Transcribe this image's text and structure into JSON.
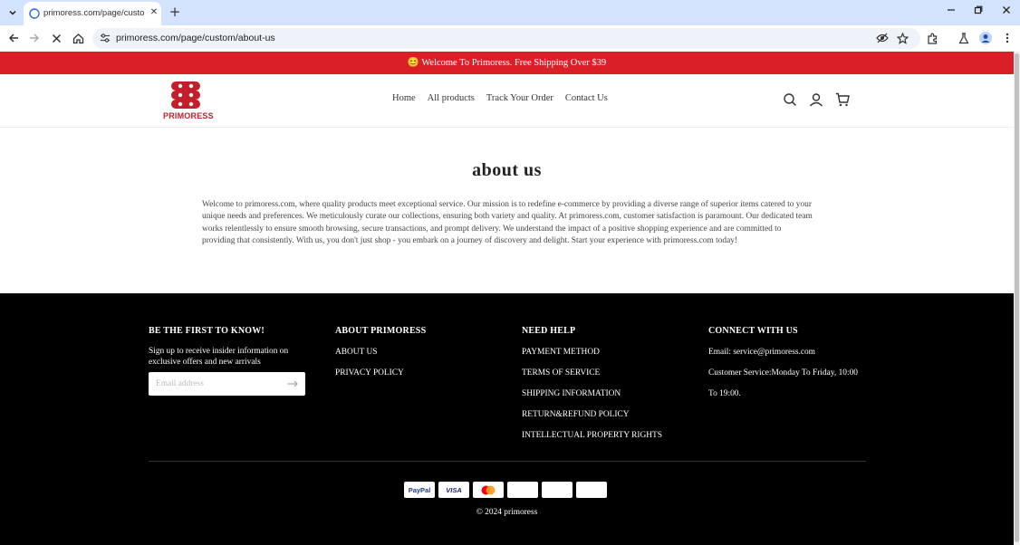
{
  "browser": {
    "tab_title": "primoress.com/page/custom/a",
    "url": "primoress.com/page/custom/about-us",
    "icons": {
      "tab_list": "chevron-down-icon",
      "close_tab": "close-icon",
      "new_tab": "plus-icon",
      "minimize": "minimize-icon",
      "restore": "restore-icon",
      "close_window": "close-icon",
      "back": "arrow-left-icon",
      "forward": "arrow-right-icon",
      "stop": "stop-icon",
      "home": "home-icon",
      "site_info": "tune-icon",
      "eye_off": "eye-off-icon",
      "bookmark": "star-icon",
      "extensions": "puzzle-icon",
      "labs": "flask-icon",
      "profile": "avatar-icon",
      "menu": "more-vert-icon"
    }
  },
  "site": {
    "announcement": "😊 Welcome To Primoress. Free Shipping Over $39",
    "announcement_color": "#d92029",
    "logo_text": "PRIMORESS",
    "brand_color": "#c41e2a",
    "nav": [
      {
        "label": "Home"
      },
      {
        "label": "All products"
      },
      {
        "label": "Track Your Order"
      },
      {
        "label": "Contact Us"
      }
    ],
    "header_icons": [
      "search-icon",
      "user-icon",
      "cart-icon"
    ]
  },
  "content": {
    "title": "about us",
    "body": "Welcome to primoress.com, where quality products meet exceptional service. Our mission is to redefine e-commerce by providing a diverse range of superior items catered to your unique needs and preferences. We meticulously curate our collections, ensuring both variety and quality. At primoress.com, customer satisfaction is paramount. Our dedicated team works relentlessly to ensure smooth browsing, secure transactions, and prompt delivery. We understand the impact of a positive shopping experience and are committed to providing that consistently. With us, you don't just shop - you embark on a journey of discovery and delight. Start your experience with primoress.com today!"
  },
  "footer": {
    "subscribe": {
      "heading": "BE THE FIRST TO KNOW!",
      "text": "Sign up to receive insider information on exclusive offers and new arrivals",
      "email_placeholder": "Email address",
      "submit_icon": "arrow-right-icon"
    },
    "about": {
      "heading": "ABOUT PRIMORESS",
      "links": [
        {
          "label": "ABOUT US"
        },
        {
          "label": "PRIVACY POLICY"
        }
      ]
    },
    "help": {
      "heading": "NEED HELP",
      "links": [
        {
          "label": "PAYMENT METHOD"
        },
        {
          "label": "TERMS OF SERVICE"
        },
        {
          "label": "SHIPPING INFORMATION"
        },
        {
          "label": "RETURN&REFUND POLICY"
        },
        {
          "label": "INTELLECTUAL PROPERTY RIGHTS"
        }
      ]
    },
    "connect": {
      "heading": "CONNECT WITH US",
      "email": "Email: service@primoress.com",
      "service_hours": "Customer Service:Monday To Friday, 10:00 To 19:00."
    },
    "payments": [
      {
        "name": "paypal",
        "label": "PayPal"
      },
      {
        "name": "visa",
        "label": "VISA"
      },
      {
        "name": "mastercard",
        "label": ""
      },
      {
        "name": "blank-card-1",
        "label": ""
      },
      {
        "name": "blank-card-2",
        "label": ""
      },
      {
        "name": "blank-card-3",
        "label": ""
      }
    ],
    "copyright": "© 2024 primoress"
  }
}
